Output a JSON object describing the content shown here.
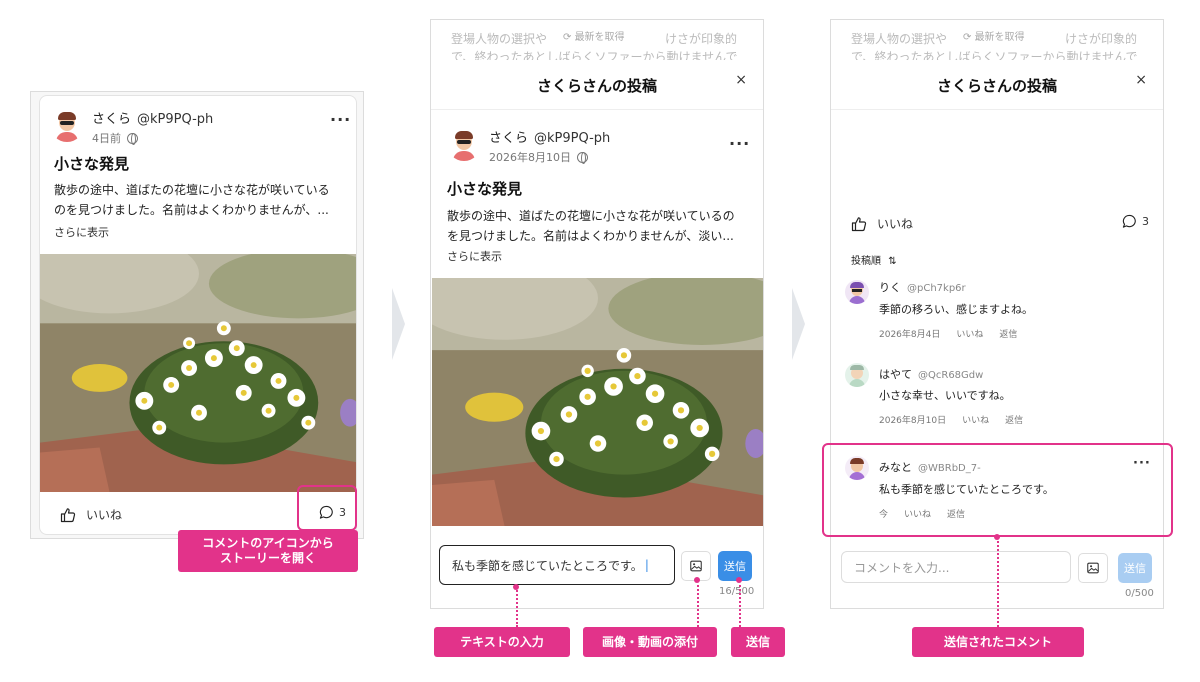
{
  "post": {
    "author_name": "さくら",
    "author_handle": "@kP9PQ-ph",
    "relative_time": "4日前",
    "date": "2026年8月10日",
    "title": "小さな発見",
    "body_line1": "散歩の途中、道ばたの花壇に小さな花が咲いている",
    "body_line2_a": "のを見つけました。名前はよくわかりませんが、...",
    "body_line1_b": "散歩の途中、道ばたの花壇に小さな花が咲いているの",
    "body_line2_b": "を見つけました。名前はよくわかりませんが、淡い...",
    "show_more": "さらに表示",
    "like_label": "いいね",
    "comment_count": "3"
  },
  "modal": {
    "title": "さくらさんの投稿",
    "close": "×",
    "bg_text_1": "登場人物の選択や",
    "bg_text_2": "けさが印象的",
    "bg_text_3": "で、終わったあとしばらくソファーから動けませんで",
    "refresh_label": "最新を取得"
  },
  "composer": {
    "typed_value": "私も季節を感じていたところです。",
    "placeholder": "コメントを入力...",
    "send_label": "送信",
    "counter_typed": "16/500",
    "counter_empty": "0/500"
  },
  "comments": {
    "sort_label": "投稿順",
    "reply_label": "返信",
    "like_label": "いいね",
    "items": [
      {
        "name": "りく",
        "handle": "@pCh7kp6r",
        "text": "季節の移ろい、感じますよね。",
        "time": "2026年8月4日"
      },
      {
        "name": "はやて",
        "handle": "@QcR68Gdw",
        "text": "小さな幸せ、いいですね。",
        "time": "2026年8月10日"
      },
      {
        "name": "みなと",
        "handle": "@WBRbD_7-",
        "text": "私も季節を感じていたところです。",
        "time": "今"
      }
    ]
  },
  "callouts": {
    "open_story": "コメントのアイコンから\nストーリーを開く",
    "text_input": "テキストの入力",
    "attach_media": "画像・動画の添付",
    "send": "送信",
    "sent_comment": "送信されたコメント"
  },
  "colors": {
    "accent_pink": "#e2338a",
    "send_blue": "#3a8ee6",
    "send_blue_disabled": "#a9cdf2"
  }
}
